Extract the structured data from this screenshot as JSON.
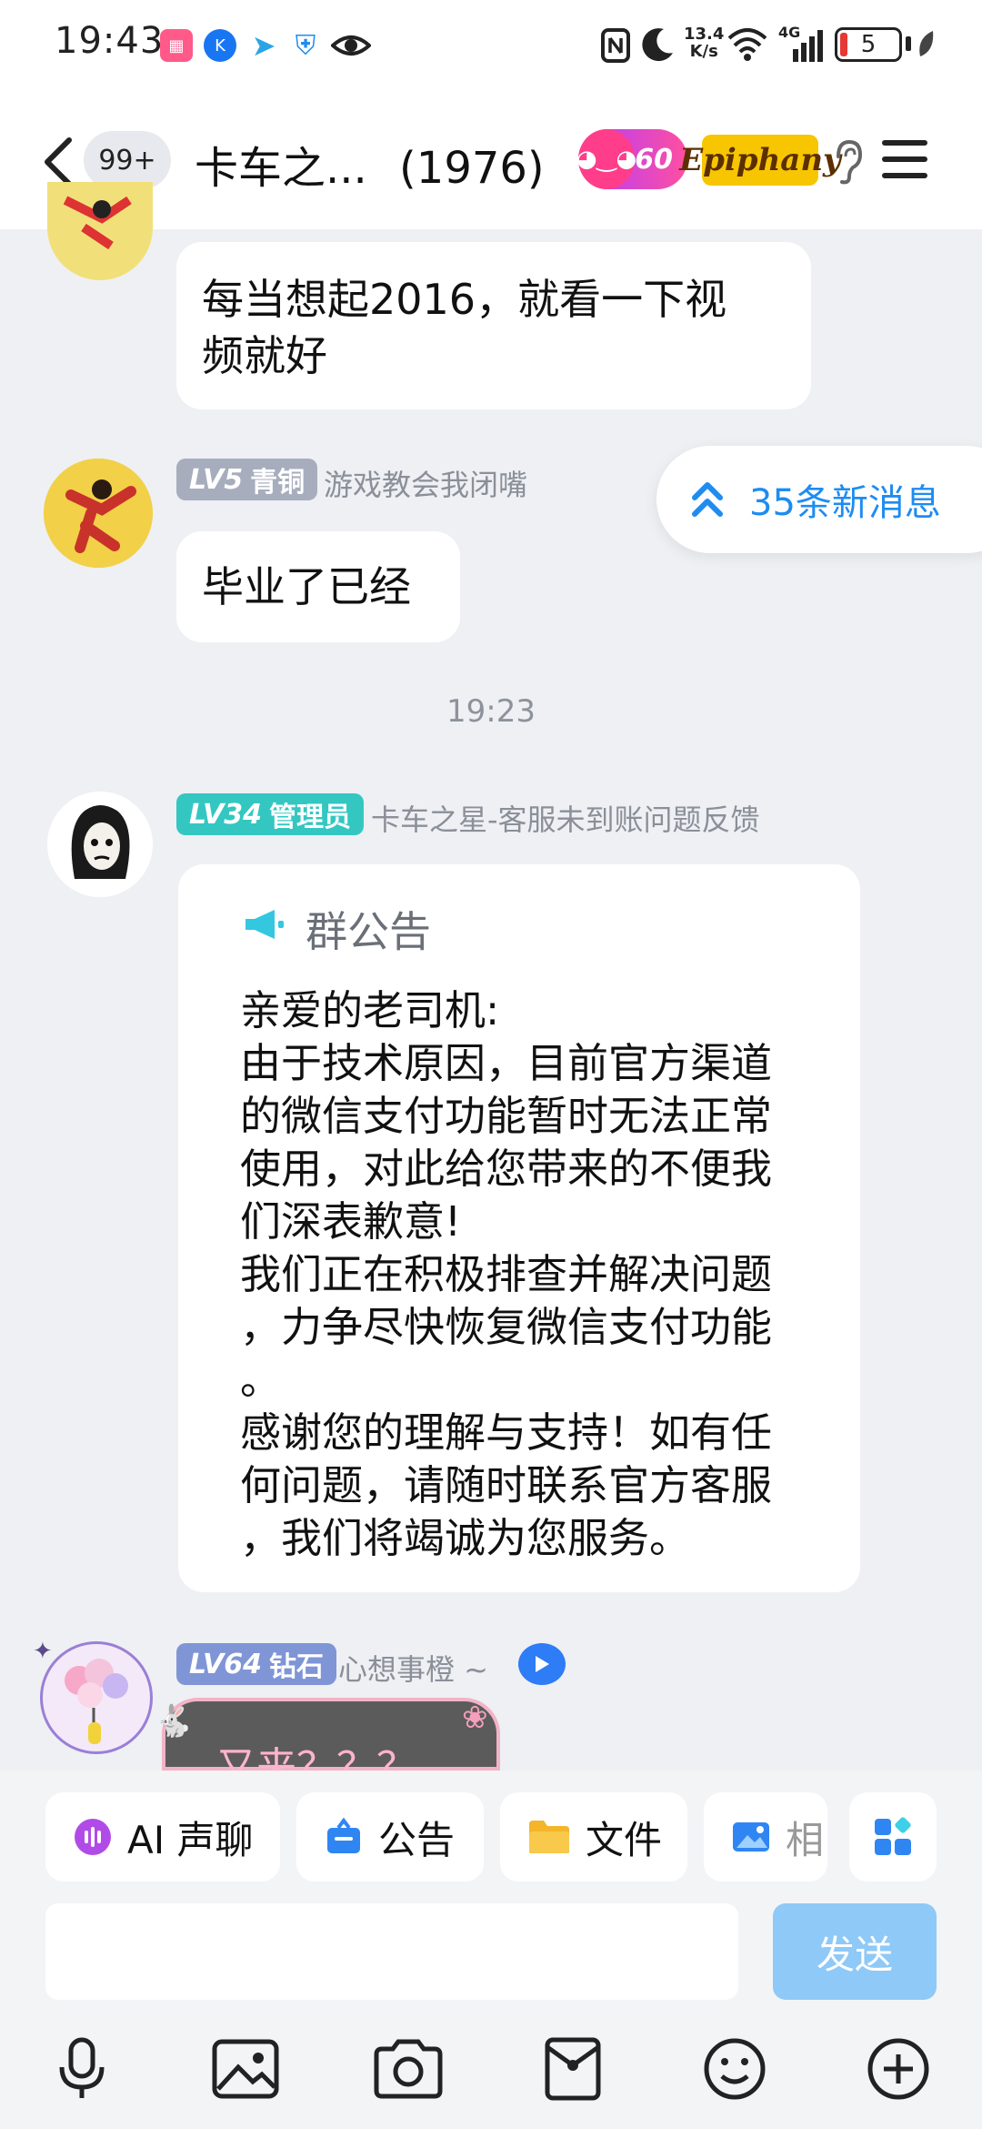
{
  "status_bar": {
    "time": "19:43",
    "net_speed_value": "13.4",
    "net_speed_unit": "K/s",
    "network_type": "4G",
    "battery": "5"
  },
  "header": {
    "unread_badge": "99+",
    "title": "卡车之...",
    "member_count": "(1976)",
    "fire_level": "60",
    "group_tag": "Epiphany"
  },
  "new_messages": "35条新消息",
  "messages": [
    {
      "text": "每当想起2016，就看一下视\n频就好"
    },
    {
      "level": "LV5",
      "badge": "青铜",
      "nickname": "游戏教会我闭嘴",
      "text": "毕业了已经"
    }
  ],
  "time_separator": "19:23",
  "notice_message": {
    "level": "LV34",
    "badge": "管理员",
    "nickname": "卡车之星-客服未到账问题反馈",
    "title": "群公告",
    "body": "亲爱的老司机:\n由于技术原因，目前官方渠道\n的微信支付功能暂时无法正常\n使用，对此给您带来的不便我\n们深表歉意!\n我们正在积极排查并解决问题\n，力争尽快恢复微信支付功能\n。\n感谢您的理解与支持！如有任\n何问题，请随时联系官方客服\n，我们将竭诚为您服务。"
  },
  "last_message": {
    "level": "LV64",
    "badge": "钻石",
    "nickname": "心想事橙 ~",
    "sticker_text": "又来？？？"
  },
  "quick_actions": [
    "AI 声聊",
    "公告",
    "文件",
    "相"
  ],
  "composer": {
    "send_label": "发送"
  },
  "toolbar_icons": [
    "microphone-icon",
    "image-icon",
    "camera-icon",
    "red-packet-icon",
    "emoji-icon",
    "plus-icon"
  ],
  "colors": {
    "accent": "#1e8cf0",
    "send_disabled": "#8fc9f7",
    "level_bronze": "#a7adbd",
    "level_admin": "#34c7c1",
    "level_diamond": "#7f95d6"
  }
}
